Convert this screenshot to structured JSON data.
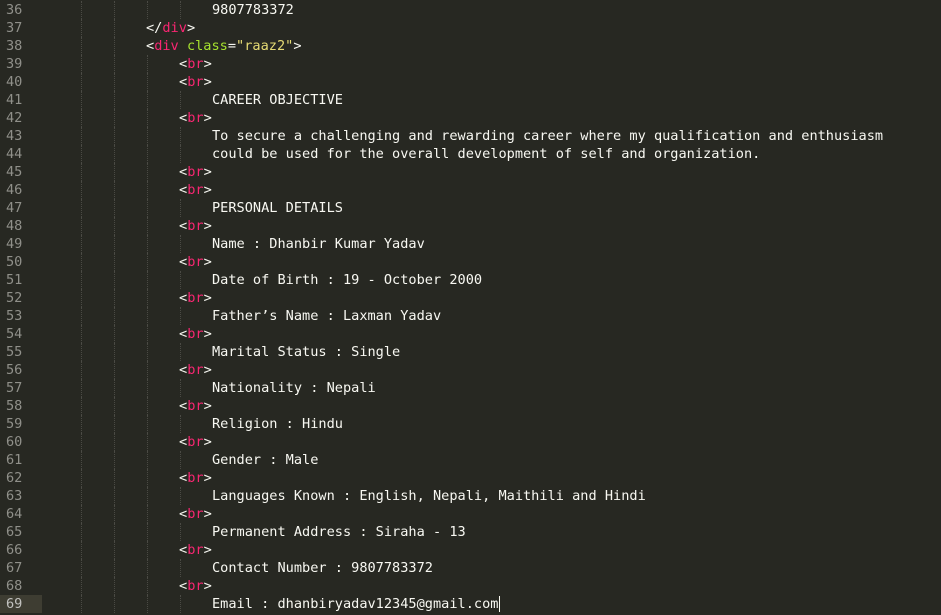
{
  "editor": {
    "lines": [
      {
        "n": "36",
        "type": "text",
        "text": "9807783372"
      },
      {
        "n": "37",
        "type": "close",
        "tag": "div"
      },
      {
        "n": "38",
        "type": "opendivattr",
        "tag": "div",
        "attr": "class",
        "value": "\"raaz2\""
      },
      {
        "n": "39",
        "type": "br",
        "tag": "br"
      },
      {
        "n": "40",
        "type": "br",
        "tag": "br"
      },
      {
        "n": "41",
        "type": "text",
        "text": "CAREER OBJECTIVE"
      },
      {
        "n": "42",
        "type": "br",
        "tag": "br"
      },
      {
        "n": "43",
        "type": "text",
        "text": "To secure a challenging and rewarding career where my qualification and enthusiasm"
      },
      {
        "n": "44",
        "type": "text",
        "text": "could be used for the overall development of self and organization."
      },
      {
        "n": "45",
        "type": "br",
        "tag": "br"
      },
      {
        "n": "46",
        "type": "br",
        "tag": "br"
      },
      {
        "n": "47",
        "type": "text",
        "text": "PERSONAL DETAILS"
      },
      {
        "n": "48",
        "type": "br",
        "tag": "br"
      },
      {
        "n": "49",
        "type": "text",
        "text": "Name : Dhanbir Kumar Yadav"
      },
      {
        "n": "50",
        "type": "br",
        "tag": "br"
      },
      {
        "n": "51",
        "type": "text",
        "text": "Date of Birth : 19 - October 2000"
      },
      {
        "n": "52",
        "type": "br",
        "tag": "br"
      },
      {
        "n": "53",
        "type": "text",
        "text": "Father’s Name : Laxman Yadav"
      },
      {
        "n": "54",
        "type": "br",
        "tag": "br"
      },
      {
        "n": "55",
        "type": "text",
        "text": "Marital Status : Single"
      },
      {
        "n": "56",
        "type": "br",
        "tag": "br"
      },
      {
        "n": "57",
        "type": "text",
        "text": "Nationality : Nepali"
      },
      {
        "n": "58",
        "type": "br",
        "tag": "br"
      },
      {
        "n": "59",
        "type": "text",
        "text": "Religion : Hindu"
      },
      {
        "n": "60",
        "type": "br",
        "tag": "br"
      },
      {
        "n": "61",
        "type": "text",
        "text": "Gender : Male"
      },
      {
        "n": "62",
        "type": "br",
        "tag": "br"
      },
      {
        "n": "63",
        "type": "text",
        "text": "Languages Known : English, Nepali, Maithili and Hindi"
      },
      {
        "n": "64",
        "type": "br",
        "tag": "br"
      },
      {
        "n": "65",
        "type": "text",
        "text": "Permanent Address : Siraha - 13"
      },
      {
        "n": "66",
        "type": "br",
        "tag": "br"
      },
      {
        "n": "67",
        "type": "text",
        "text": "Contact Number : 9807783372"
      },
      {
        "n": "68",
        "type": "br",
        "tag": "br"
      },
      {
        "n": "69",
        "type": "text",
        "text": "Email : dhanbiryadav12345@gmail.com",
        "current": true,
        "caret": true
      }
    ]
  },
  "theme": {
    "background": "#272822",
    "foreground": "#f8f8f2",
    "tag": "#f92672",
    "attribute": "#a6e22e",
    "string": "#e6db74",
    "line_number": "#90908a",
    "current_line": "#3e3d32"
  }
}
